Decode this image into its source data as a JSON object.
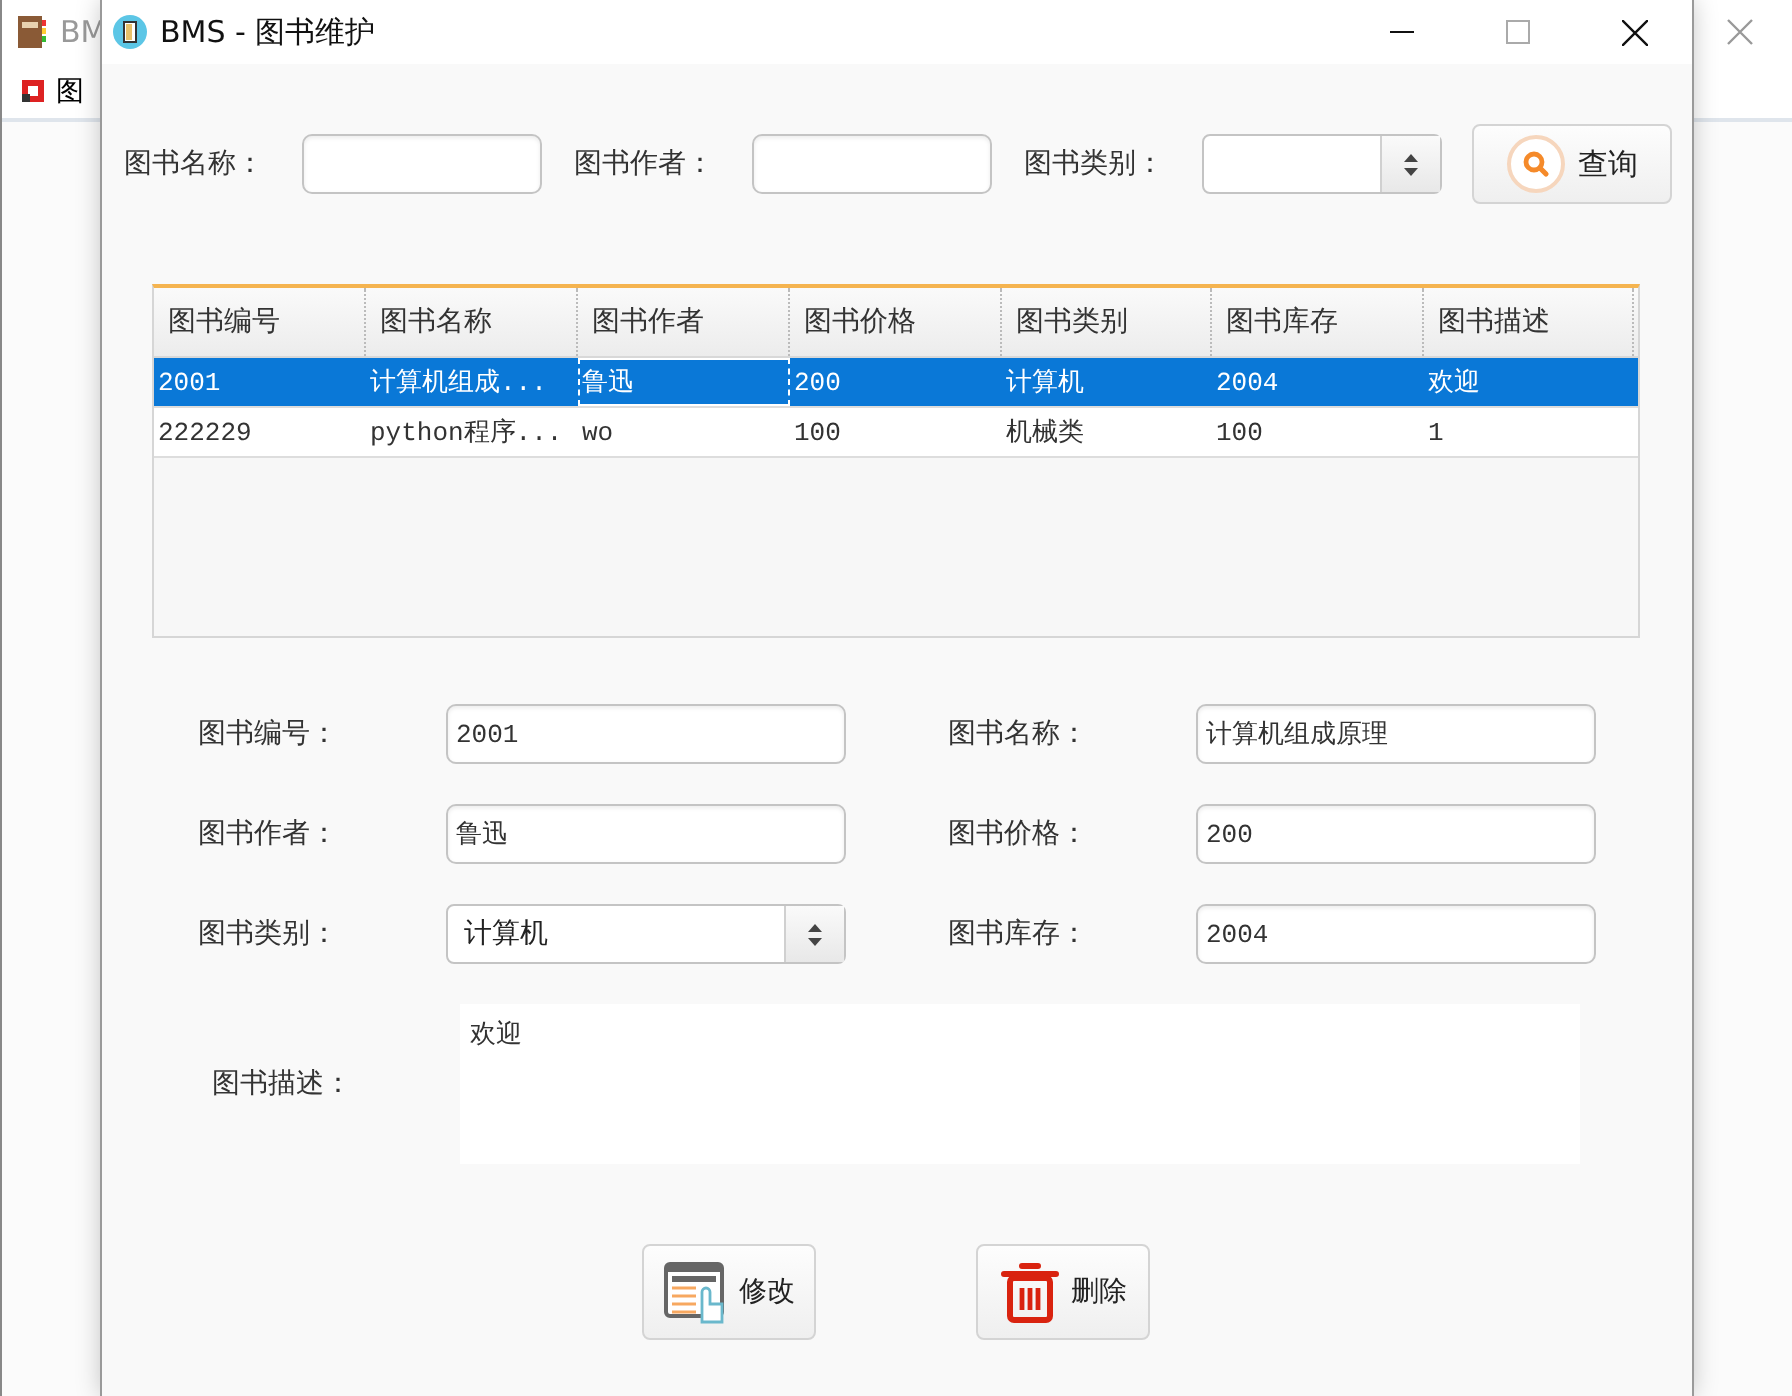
{
  "background_window": {
    "title": "BM",
    "menu": [
      "图"
    ]
  },
  "window": {
    "title": "BMS - 图书维护"
  },
  "search": {
    "fields": [
      {
        "label": "图书名称：",
        "kind": "text"
      },
      {
        "label": "图书作者：",
        "kind": "text"
      },
      {
        "label": "图书类别：",
        "kind": "combo"
      }
    ],
    "button": "查询"
  },
  "table": {
    "columns": [
      "图书编号",
      "图书名称",
      "图书作者",
      "图书价格",
      "图书类别",
      "图书库存",
      "图书描述"
    ],
    "rows": [
      {
        "selected": true,
        "cells": [
          {
            "text": "2001",
            "focused": false
          },
          {
            "text": "计算机组成...",
            "focused": false
          },
          {
            "text": "鲁迅",
            "focused": true
          },
          {
            "text": "200",
            "focused": false
          },
          {
            "text": "计算机",
            "focused": false
          },
          {
            "text": "2004",
            "focused": false
          },
          {
            "text": "欢迎",
            "focused": false
          }
        ]
      },
      {
        "selected": false,
        "cells": [
          {
            "text": "222229",
            "focused": false
          },
          {
            "text": "python程序...",
            "focused": false
          },
          {
            "text": "wo",
            "focused": false
          },
          {
            "text": "100",
            "focused": false
          },
          {
            "text": "机械类",
            "focused": false
          },
          {
            "text": "100",
            "focused": false
          },
          {
            "text": "1",
            "focused": false
          }
        ]
      }
    ]
  },
  "form": {
    "fields": [
      {
        "label": "图书编号：",
        "value": "2001",
        "kind": "text"
      },
      {
        "label": "图书名称：",
        "value": "计算机组成原理",
        "kind": "text"
      },
      {
        "label": "图书作者：",
        "value": "鲁迅",
        "kind": "text"
      },
      {
        "label": "图书价格：",
        "value": "200",
        "kind": "text"
      },
      {
        "label": "图书类别：",
        "value": "计算机",
        "kind": "combo"
      },
      {
        "label": "图书库存：",
        "value": "2004",
        "kind": "text"
      }
    ],
    "description": {
      "label": "图书描述：",
      "value": "欢迎"
    }
  },
  "buttons": [
    {
      "label": "修改",
      "kind": "edit"
    },
    {
      "label": "删除",
      "kind": "delete"
    }
  ]
}
